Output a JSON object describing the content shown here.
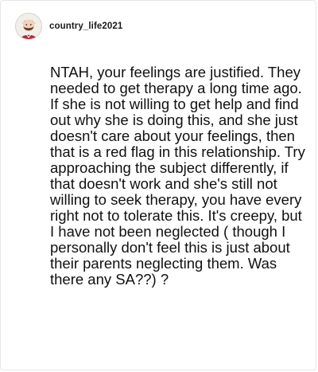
{
  "post": {
    "username": "country_life2021",
    "avatar_icon": "bearded-cartoon-avatar-icon",
    "body": "NTAH, your feelings are justified. They needed to get therapy a long time ago. If she is not willing to get help and find out why she is doing this, and she just doesn't care about your feelings, then that is a red flag in this relationship. Try approaching the subject differently, if that doesn't work and she's still not willing to seek therapy, you have every right not to tolerate this. It's creepy, but I have not been neglected ( though I personally don't feel this is just about their parents neglecting them. Was there any SA??) ?"
  }
}
